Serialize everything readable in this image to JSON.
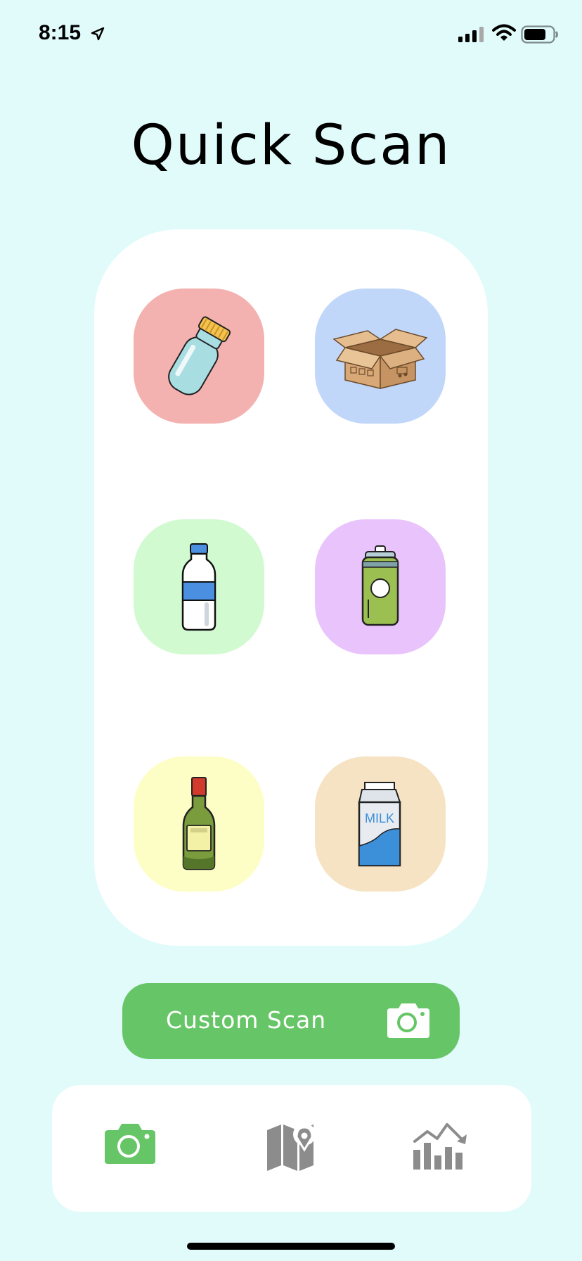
{
  "status_bar": {
    "time": "8:15",
    "icons": [
      "location-arrow-icon",
      "cellular-signal-icon",
      "wifi-icon",
      "battery-icon"
    ]
  },
  "page_title": "Quick Scan",
  "quick_scan_items": [
    {
      "icon": "glass-jar-icon",
      "color": "#f3b2b0"
    },
    {
      "icon": "cardboard-box-icon",
      "color": "#c1d7fa"
    },
    {
      "icon": "plastic-water-bottle-icon",
      "color": "#d1fad1"
    },
    {
      "icon": "soda-can-icon",
      "color": "#e9c3fb"
    },
    {
      "icon": "glass-wine-bottle-icon",
      "color": "#fdfec6"
    },
    {
      "icon": "milk-carton-icon",
      "color": "#f6e3c4",
      "label": "MILK"
    }
  ],
  "custom_scan": {
    "label": "Custom Scan",
    "icon": "camera-icon",
    "color": "#66c667"
  },
  "tab_bar": {
    "tabs": [
      {
        "icon": "camera-icon",
        "active": true,
        "color": "#66c667"
      },
      {
        "icon": "map-pin-icon",
        "active": false,
        "color": "#8c8c8c"
      },
      {
        "icon": "bar-chart-trend-icon",
        "active": false,
        "color": "#8c8c8c"
      }
    ]
  }
}
